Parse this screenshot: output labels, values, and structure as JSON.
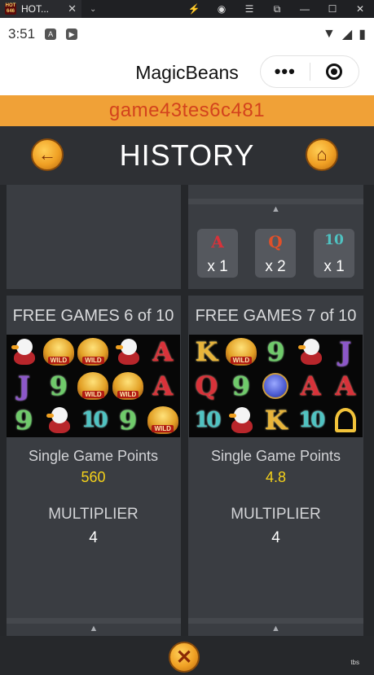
{
  "browser": {
    "tab_title": "HOT...",
    "favicon_text": "HOT 646",
    "tab_close": "✕",
    "tab_menu": "⌄",
    "controls": [
      "⚡",
      "◉",
      "☰",
      "⧉",
      "—",
      "☐",
      "✕"
    ]
  },
  "statusbar": {
    "time": "3:51",
    "icons": [
      "A",
      "▶"
    ],
    "right_icons": [
      "▼",
      "◢",
      "▮"
    ]
  },
  "app": {
    "title": "MagicBeans",
    "more_icon": "•••"
  },
  "game_id": "game43tes6c481",
  "history": {
    "title": "HISTORY",
    "back_glyph": "←",
    "home_glyph": "⌂"
  },
  "top_panel_right": {
    "arrow": "▲",
    "symbols": [
      {
        "symbol": "A",
        "color": "#d8323a",
        "count": "x 1"
      },
      {
        "symbol": "Q",
        "color": "#e0502a",
        "count": "x 2"
      },
      {
        "symbol": "10",
        "color": "#4fc3c2",
        "count": "x 1"
      }
    ]
  },
  "rounds": [
    {
      "title": "FREE GAMES 6 of 10",
      "grid": [
        [
          "goose",
          "wild",
          "wild",
          "goose",
          "A"
        ],
        [
          "J",
          "9",
          "wild",
          "wild",
          "A"
        ],
        [
          "9",
          "goose",
          "10",
          "9",
          "wild"
        ]
      ],
      "points_label": "Single Game Points",
      "points_value": "560",
      "multiplier_label": "MULTIPLIER",
      "multiplier_value": "4",
      "arrow": "▲"
    },
    {
      "title": "FREE GAMES 7 of 10",
      "grid": [
        [
          "K",
          "wild",
          "9",
          "goose",
          "J"
        ],
        [
          "Q",
          "9",
          "ogre",
          "A",
          "A"
        ],
        [
          "10",
          "goose",
          "K",
          "10",
          "harp"
        ]
      ],
      "points_label": "Single Game Points",
      "points_value": "4.8",
      "multiplier_label": "MULTIPLIER",
      "multiplier_value": "4",
      "arrow": "▲"
    }
  ],
  "wild_label": "WILD",
  "close_glyph": "✕",
  "corner_text": "tbs"
}
